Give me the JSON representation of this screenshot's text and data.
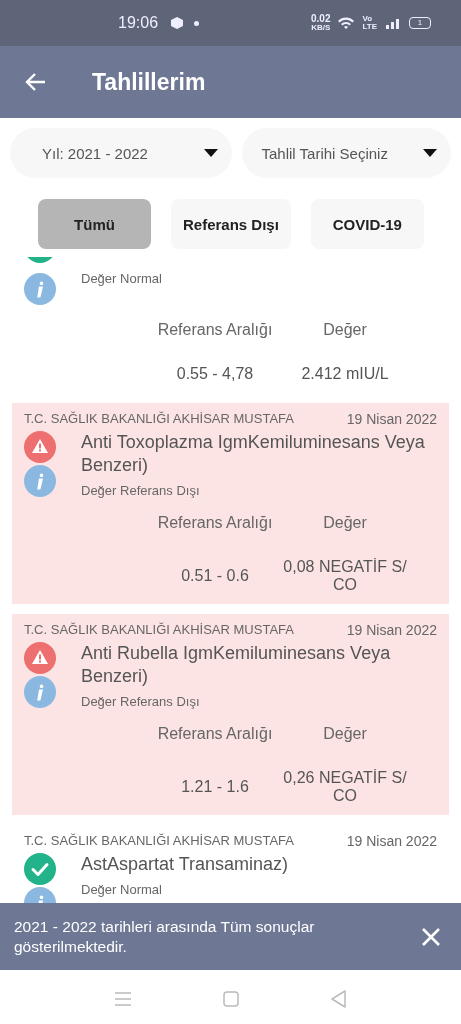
{
  "status_bar": {
    "time": "19:06",
    "speed": "0.02",
    "speed_unit": "KB/S",
    "volte_top": "Vo",
    "volte_bottom": "LTE",
    "battery": "1"
  },
  "app_bar": {
    "title": "Tahlillerim"
  },
  "filters": [
    {
      "label": "Yıl: 2021 - 2022"
    },
    {
      "label": "Tahlil Tarihi Seçiniz"
    }
  ],
  "tabs": [
    {
      "label": "Tümü",
      "selected": true
    },
    {
      "label": "Referans Dışı",
      "selected": false
    },
    {
      "label": "COVID-19",
      "selected": false
    }
  ],
  "results": [
    {
      "kind": "normal",
      "note": "Değer Normal",
      "range_label": "Referans Aralığı",
      "value_label": "Değer",
      "range": "0.55 - 4,78",
      "value": "2.412 mIU/L"
    },
    {
      "hospital": "T.C. SAĞLIK BAKANLIĞI AKHİSAR MUSTAFA",
      "date": "19 Nisan 2022",
      "kind": "out_of_range",
      "name": "Anti Toxoplazma IgmKemiluminesans Veya Benzeri)",
      "note": "Değer Referans Dışı",
      "range_label": "Referans Aralığı",
      "value_label": "Değer",
      "range": "0.51 - 0.6",
      "value": "0,08 NEGATİF S/ CO"
    },
    {
      "hospital": "T.C. SAĞLIK BAKANLIĞI AKHİSAR MUSTAFA",
      "date": "19 Nisan 2022",
      "kind": "out_of_range",
      "name": "Anti Rubella IgmKemiluminesans Veya Benzeri)",
      "note": "Değer Referans Dışı",
      "range_label": "Referans Aralığı",
      "value_label": "Değer",
      "range": "1.21 - 1.6",
      "value": "0,26 NEGATİF S/ CO"
    },
    {
      "hospital": "T.C. SAĞLIK BAKANLIĞI AKHİSAR MUSTAFA",
      "date": "19 Nisan 2022",
      "kind": "normal",
      "name": "AstAspartat Transaminaz)",
      "note": "Değer Normal"
    }
  ],
  "snackbar": {
    "message": "2021 - 2022 tarihleri arasında Tüm sonuçlar gösterilmektedir."
  }
}
